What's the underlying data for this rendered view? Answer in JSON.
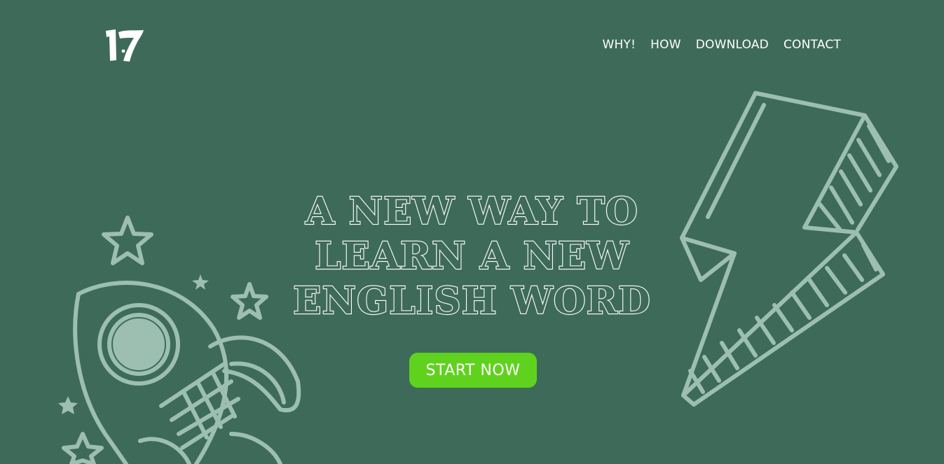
{
  "brand": {
    "logo_icon": "numeral-17-logo"
  },
  "nav": {
    "items": [
      {
        "label": "WHY!"
      },
      {
        "label": "HOW"
      },
      {
        "label": "DOWNLOAD"
      },
      {
        "label": "CONTACT"
      }
    ]
  },
  "hero": {
    "headline_lines": [
      "A NEW WAY TO",
      "LEARN A NEW",
      "ENGLISH WORD"
    ],
    "cta_label": "START NOW"
  },
  "decor": {
    "left_icon": "rocket-illustration",
    "stars_icon": "star-icon",
    "right_icon": "lightning-bolt-illustration"
  },
  "colors": {
    "background": "#3e6a5a",
    "accent": "#5fd21e",
    "illustration": "#9cbfb2",
    "text": "#ffffff"
  }
}
